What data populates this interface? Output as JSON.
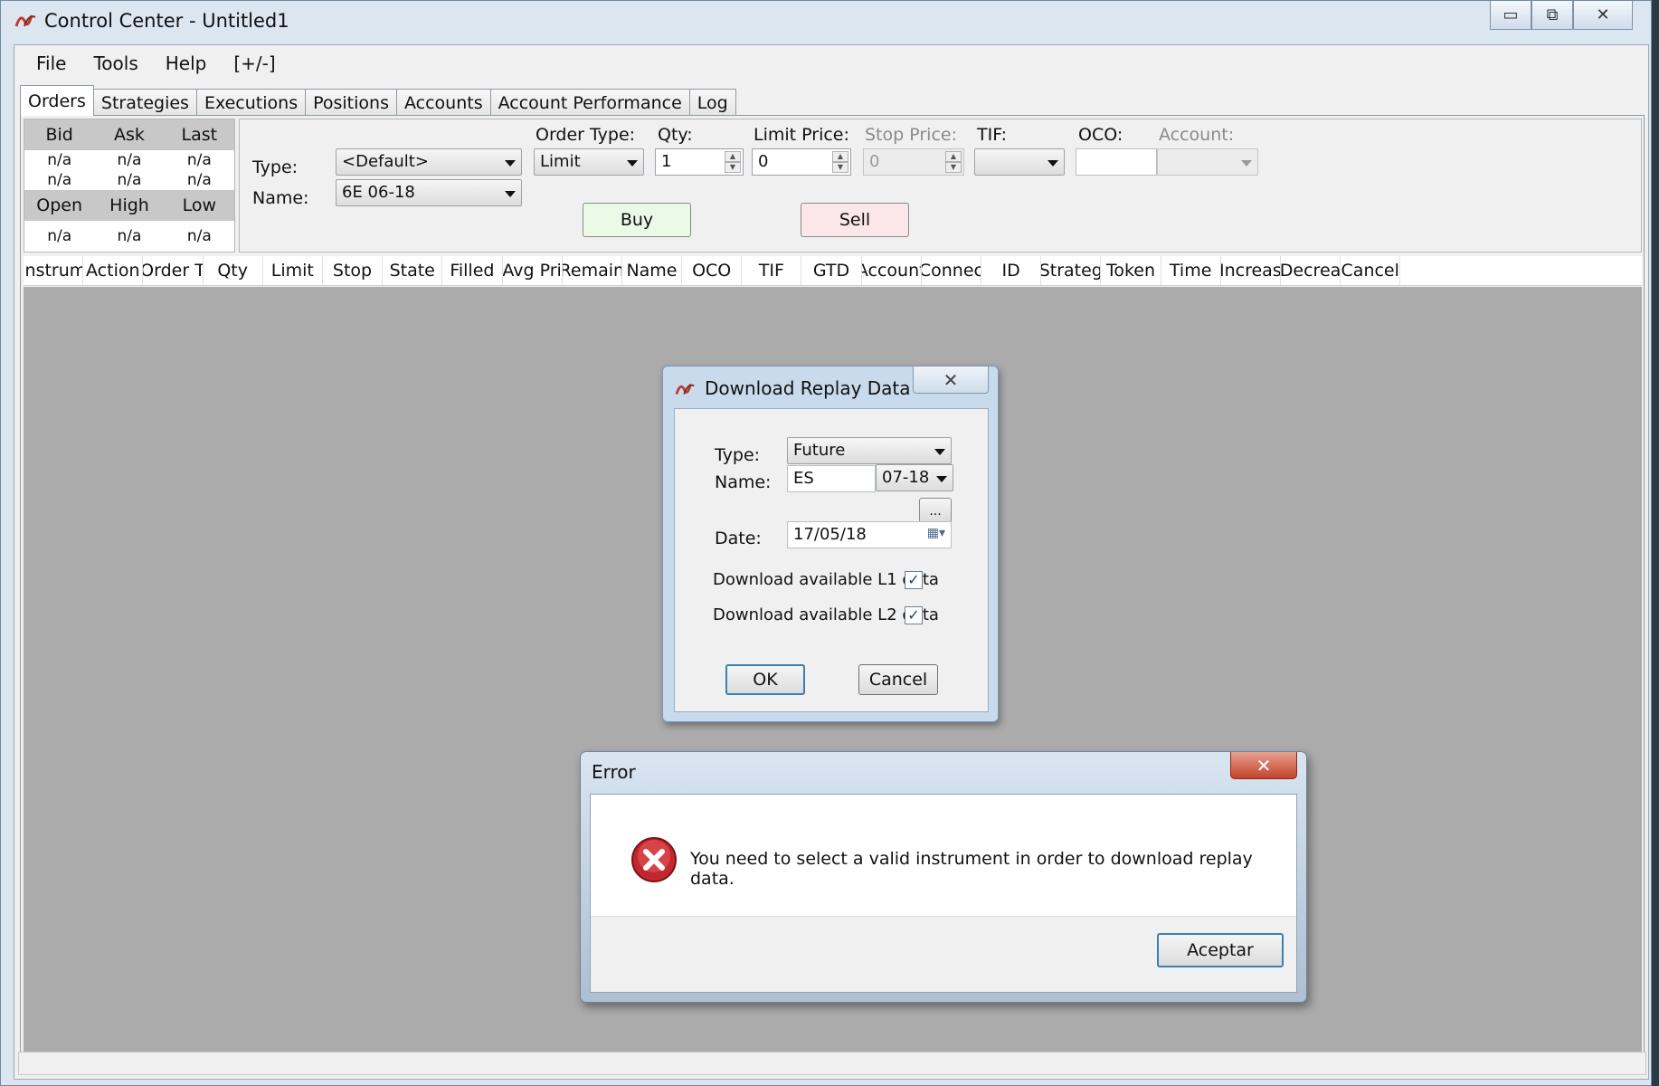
{
  "window": {
    "title": "Control Center - Untitled1"
  },
  "menu": [
    "File",
    "Tools",
    "Help",
    "[+/-]"
  ],
  "tabs": [
    "Orders",
    "Strategies",
    "Executions",
    "Positions",
    "Accounts",
    "Account Performance",
    "Log"
  ],
  "quote": {
    "top_headers": [
      "Bid",
      "Ask",
      "Last"
    ],
    "top_rows": [
      [
        "n/a",
        "n/a",
        "n/a"
      ],
      [
        "n/a",
        "n/a",
        "n/a"
      ]
    ],
    "bottom_headers": [
      "Open",
      "High",
      "Low"
    ],
    "bottom_row": [
      "n/a",
      "n/a",
      "n/a"
    ]
  },
  "order_entry": {
    "type_label": "Type:",
    "type_value": "<Default>",
    "name_label": "Name:",
    "name_value": "6E 06-18",
    "order_type_label": "Order Type:",
    "order_type_value": "Limit",
    "qty_label": "Qty:",
    "qty_value": "1",
    "limit_price_label": "Limit Price:",
    "limit_price_value": "0",
    "stop_price_label": "Stop Price:",
    "stop_price_value": "0",
    "tif_label": "TIF:",
    "oco_label": "OCO:",
    "account_label": "Account:",
    "buy_label": "Buy",
    "sell_label": "Sell"
  },
  "grid_columns": [
    "Instrum",
    "Action",
    "Order T",
    "Qty",
    "Limit",
    "Stop",
    "State",
    "Filled",
    "Avg Pri",
    "Remain",
    "Name",
    "OCO",
    "TIF",
    "GTD",
    "Account",
    "Connec",
    "ID",
    "Strateg",
    "Token",
    "Time",
    "Increas",
    "Decrea",
    "Cancel"
  ],
  "replay_dialog": {
    "title": "Download Replay Data",
    "type_label": "Type:",
    "type_value": "Future",
    "name_label": "Name:",
    "name_value": "ES",
    "expiry_value": "07-18",
    "browse_label": "...",
    "date_label": "Date:",
    "date_value": "17/05/18",
    "l1_label": "Download available L1 data",
    "l2_label": "Download available L2 data",
    "l1_checked": true,
    "l2_checked": true,
    "ok_label": "OK",
    "cancel_label": "Cancel"
  },
  "error_dialog": {
    "title": "Error",
    "message": "You need to select a valid instrument in order to download replay data.",
    "button_label": "Aceptar",
    "icon": "error-icon"
  },
  "colors": {
    "grid_background": "#ababab",
    "buy_button": "#eafae6",
    "sell_button": "#fbe6ea",
    "error_close": "#c5432a"
  }
}
